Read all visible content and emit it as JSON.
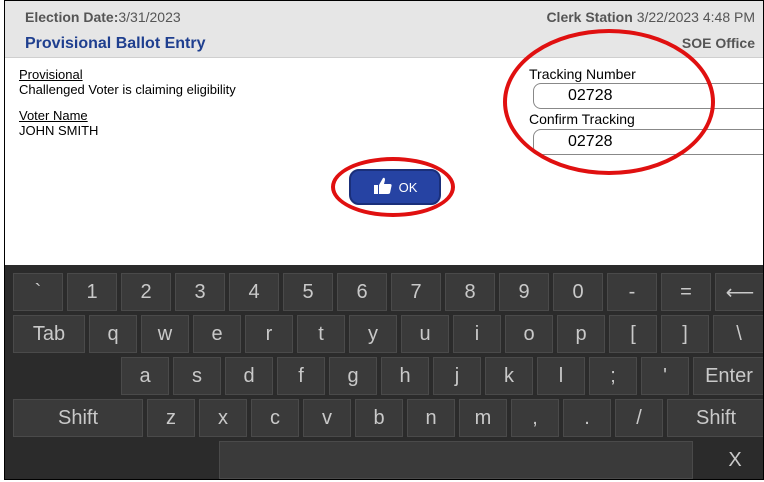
{
  "header": {
    "election_label": "Election Date:",
    "election_date": "3/31/2023",
    "title": "Provisional Ballot Entry",
    "station_label": "Clerk Station",
    "station_datetime": "3/22/2023 4:48 PM",
    "office": "SOE Office"
  },
  "info": {
    "provisional_label": "Provisional",
    "provisional_reason": "Challenged Voter is claiming eligibility",
    "voter_name_label": "Voter Name",
    "voter_name": "JOHN SMITH"
  },
  "tracking": {
    "number_label": "Tracking Number",
    "number_value": "02728",
    "confirm_label": "Confirm Tracking",
    "confirm_value": "02728"
  },
  "ok_button": {
    "label": "OK",
    "icon": "thumbs-up-icon"
  },
  "keyboard": {
    "row1": [
      "`",
      "1",
      "2",
      "3",
      "4",
      "5",
      "6",
      "7",
      "8",
      "9",
      "0",
      "-",
      "=",
      "⟵"
    ],
    "row2": [
      "Tab",
      "q",
      "w",
      "e",
      "r",
      "t",
      "y",
      "u",
      "i",
      "o",
      "p",
      "[",
      "]",
      "\\"
    ],
    "row3": [
      "a",
      "s",
      "d",
      "f",
      "g",
      "h",
      "j",
      "k",
      "l",
      ";",
      "'",
      "Enter"
    ],
    "row4": [
      "Shift",
      "z",
      "x",
      "c",
      "v",
      "b",
      "n",
      "m",
      ",",
      ".",
      "/",
      "Shift"
    ],
    "close_label": "X"
  },
  "colors": {
    "accent": "#2643a3",
    "highlight": "#e01010",
    "keyboard_bg": "#2b2b2b"
  }
}
